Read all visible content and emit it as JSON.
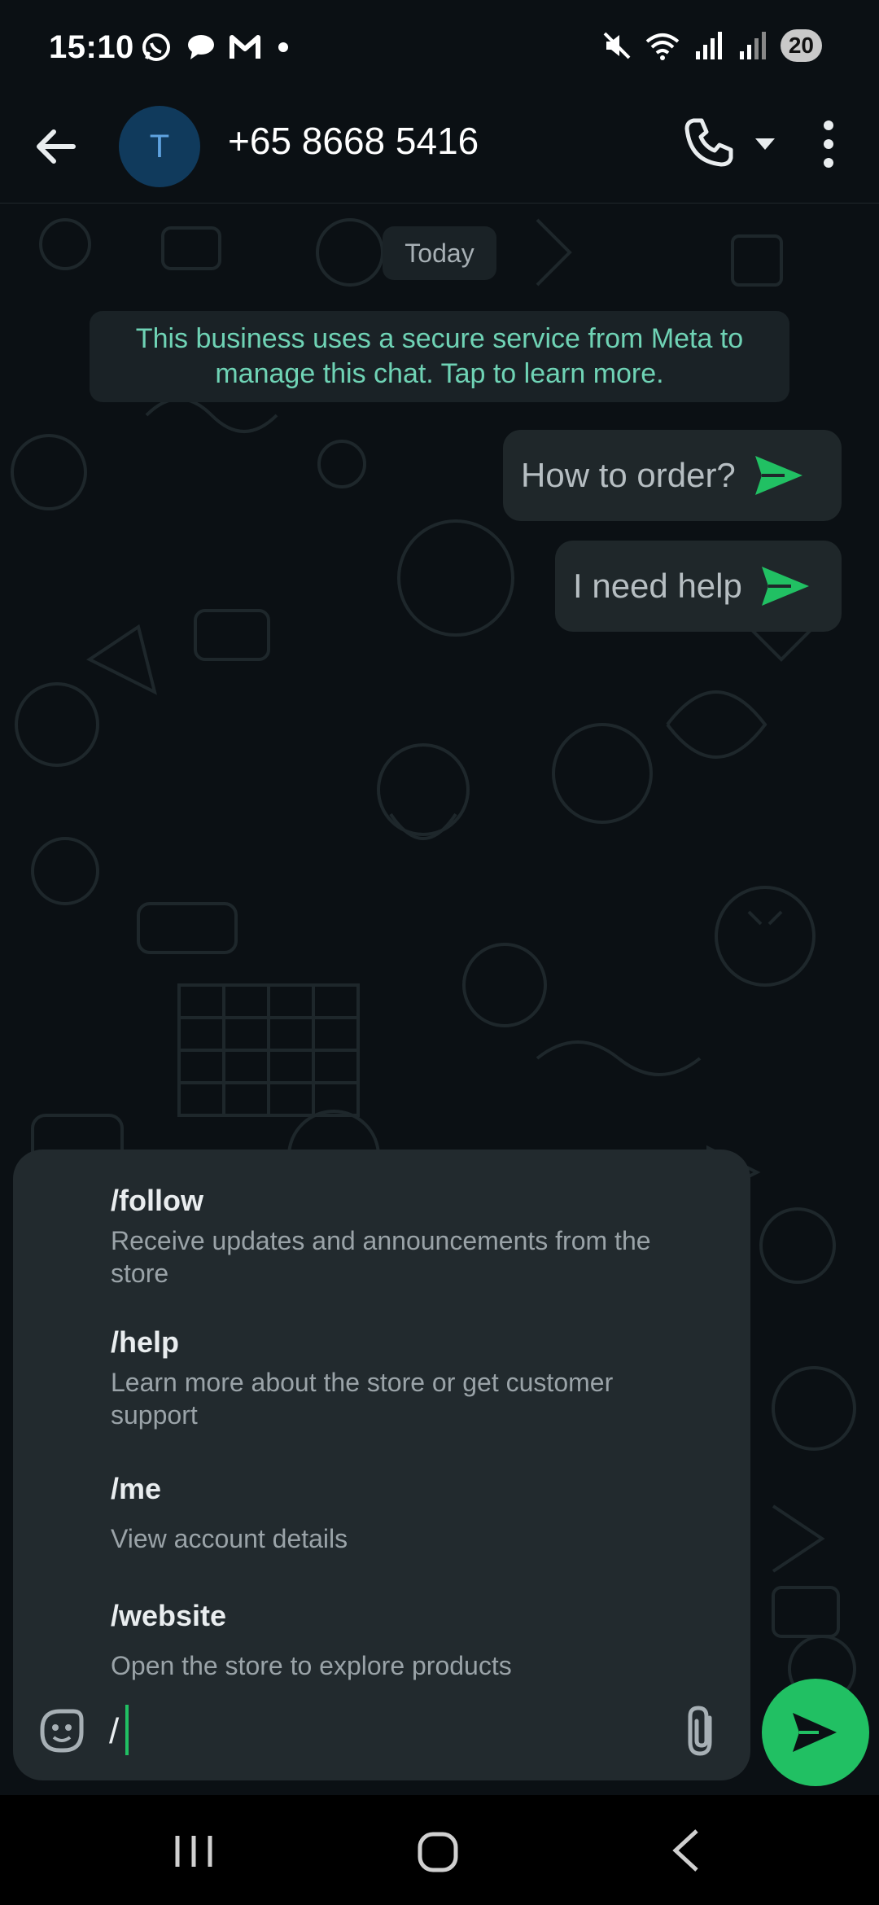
{
  "status_bar": {
    "time": "15:10",
    "battery": "20",
    "left_icons": [
      "whatsapp-icon",
      "chat-icon",
      "gmail-icon",
      "dot-icon"
    ],
    "right_icons": [
      "mute-icon",
      "wifi-icon",
      "signal-icon",
      "signal-icon"
    ]
  },
  "header": {
    "avatar_initial": "T",
    "contact_name": "+65 8668 5416"
  },
  "chat": {
    "date_chip": "Today",
    "system_message_line1": "This business uses a secure service from Meta to",
    "system_message_line2": "manage this chat. Tap to learn more.",
    "messages": [
      {
        "text": "How to order?"
      },
      {
        "text": "I need help"
      }
    ]
  },
  "commands": [
    {
      "name": "/follow",
      "desc_line1": "Receive updates and announcements from the",
      "desc_line2": "store"
    },
    {
      "name": "/help",
      "desc_line1": "Learn more about the store or get customer",
      "desc_line2": "support"
    },
    {
      "name": "/me",
      "desc_line1": "View account details"
    },
    {
      "name": "/website",
      "desc_line1": "Open the store to explore products"
    }
  ],
  "input": {
    "value": "/"
  },
  "colors": {
    "accent": "#21c063",
    "system_text": "#6fd3b5",
    "background": "#0b1014",
    "panel": "#222a2e"
  }
}
